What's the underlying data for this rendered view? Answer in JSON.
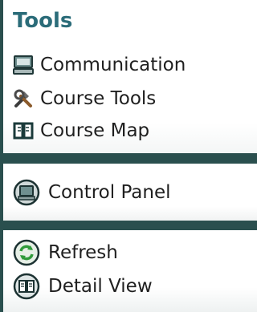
{
  "tools": {
    "title": "Tools",
    "items": [
      {
        "label": "Communication",
        "icon": "computer-icon"
      },
      {
        "label": "Course Tools",
        "icon": "tools-icon"
      },
      {
        "label": "Course Map",
        "icon": "book-icon"
      }
    ]
  },
  "control": {
    "items": [
      {
        "label": "Control Panel",
        "icon": "control-panel-icon"
      }
    ]
  },
  "view": {
    "items": [
      {
        "label": "Refresh",
        "icon": "refresh-icon"
      },
      {
        "label": "Detail View",
        "icon": "detail-view-icon"
      }
    ]
  },
  "colors": {
    "background": "#2a4f4e",
    "title": "#2b6c79",
    "text": "#1f1f1f"
  }
}
